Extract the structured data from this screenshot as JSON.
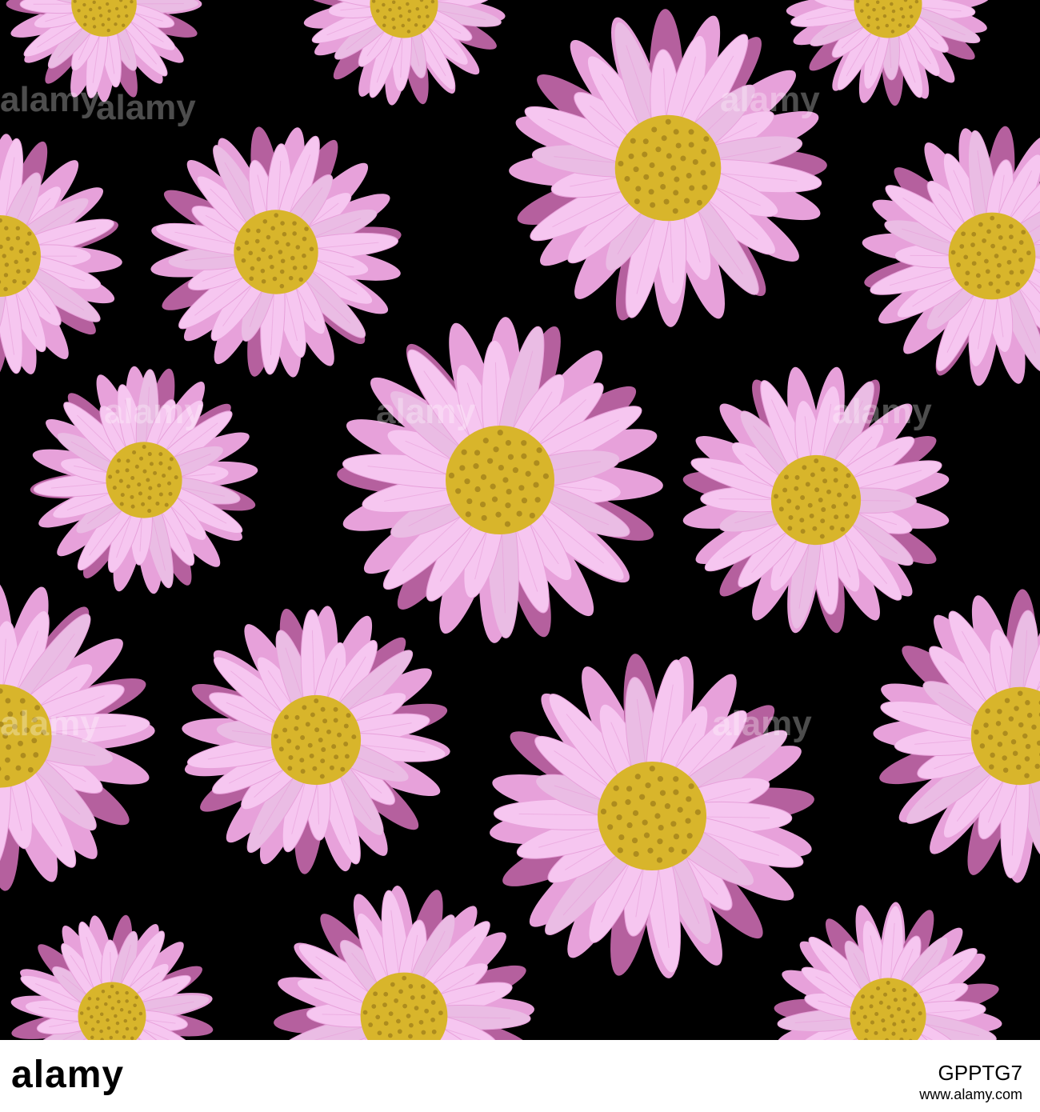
{
  "image": {
    "subject": "pink-daisy-flower",
    "colors": {
      "background": "#000000",
      "petal_light": "#f6c6f0",
      "petal_mid": "#e7a1da",
      "petal_dark": "#b5609e",
      "center": "#d8b52b",
      "center_dot": "#8b6a14",
      "footer_bg": "#ffffff",
      "footer_text": "#000000"
    }
  },
  "footer": {
    "logo": "alamy",
    "image_id": "GPPTG7",
    "url": "www.alamy.com"
  },
  "watermark": {
    "text": "alamy"
  }
}
